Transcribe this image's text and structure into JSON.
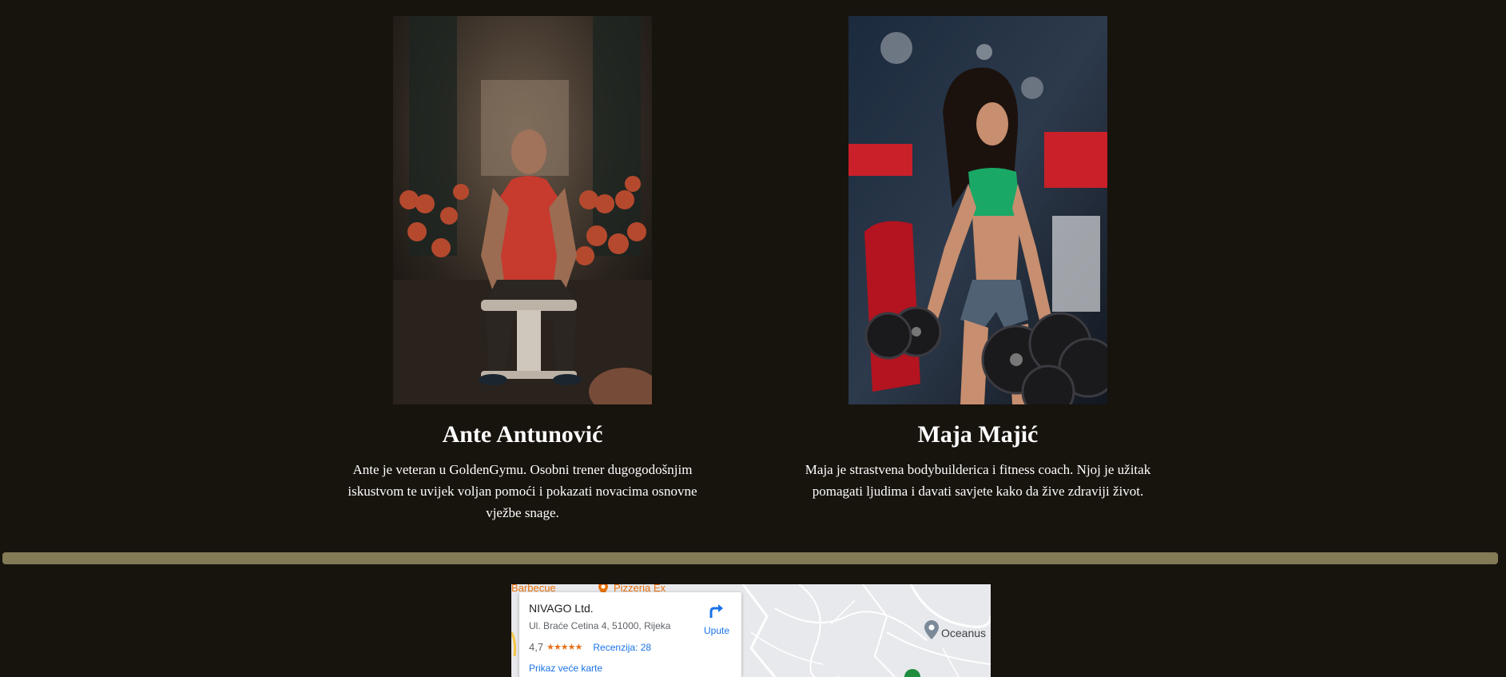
{
  "trainers": [
    {
      "name": "Ante Antunović",
      "bio": "Ante je veteran u GoldenGymu. Osobni trener dugogodošnjim iskustvom te uvijek voljan pomoći i pokazati novacima osnovne vježbe snage."
    },
    {
      "name": "Maja Majić",
      "bio": "Maja je strastvena bodybuilderica i fitness coach. Njoj je užitak pomagati ljudima i davati savjete kako da žive zdraviji život."
    }
  ],
  "divider": {
    "color": "#837a56"
  },
  "map": {
    "place_name": "NIVAGO Ltd.",
    "address": "Ul. Braće Cetina 4, 51000, Rijeka",
    "rating": "4,7",
    "stars": "★★★★★",
    "reviews_label": "Recenzija: 28",
    "larger_map_label": "Prikaz veće karte",
    "directions_label": "Upute",
    "poi": {
      "pizzeria": "Pizzeria Ex",
      "barbecue": "Barbecue",
      "oceanus": "Oceanus"
    }
  },
  "colors": {
    "background": "#17130d",
    "link": "#1a73e8",
    "star": "#e7711b"
  }
}
